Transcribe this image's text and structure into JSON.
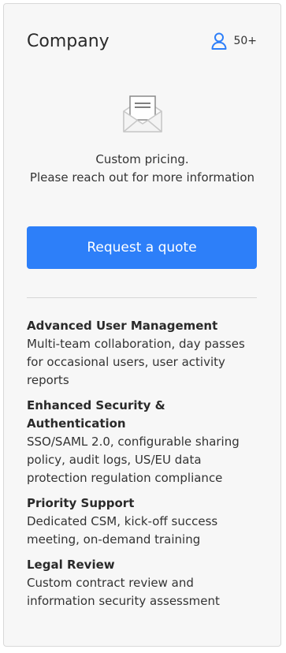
{
  "plan": {
    "name": "Company",
    "seats": "50+",
    "seats_icon": "user-icon",
    "accent_color": "#2d7ff9"
  },
  "pricing": {
    "icon": "envelope-icon",
    "line1": "Custom pricing.",
    "line2": "Please reach out for more information"
  },
  "cta": {
    "label": "Request a quote"
  },
  "features": [
    {
      "title": "Advanced User Management",
      "description": "Multi-team collaboration, day passes for occasional users, user activity reports"
    },
    {
      "title": "Enhanced Security & Authentication",
      "description": "SSO/SAML 2.0, configurable sharing policy, audit logs, US/EU data protection regulation compliance"
    },
    {
      "title": "Priority Support",
      "description": "Dedicated CSM, kick-off success meeting, on-demand training"
    },
    {
      "title": "Legal Review",
      "description": "Custom contract review and information security assessment"
    }
  ]
}
